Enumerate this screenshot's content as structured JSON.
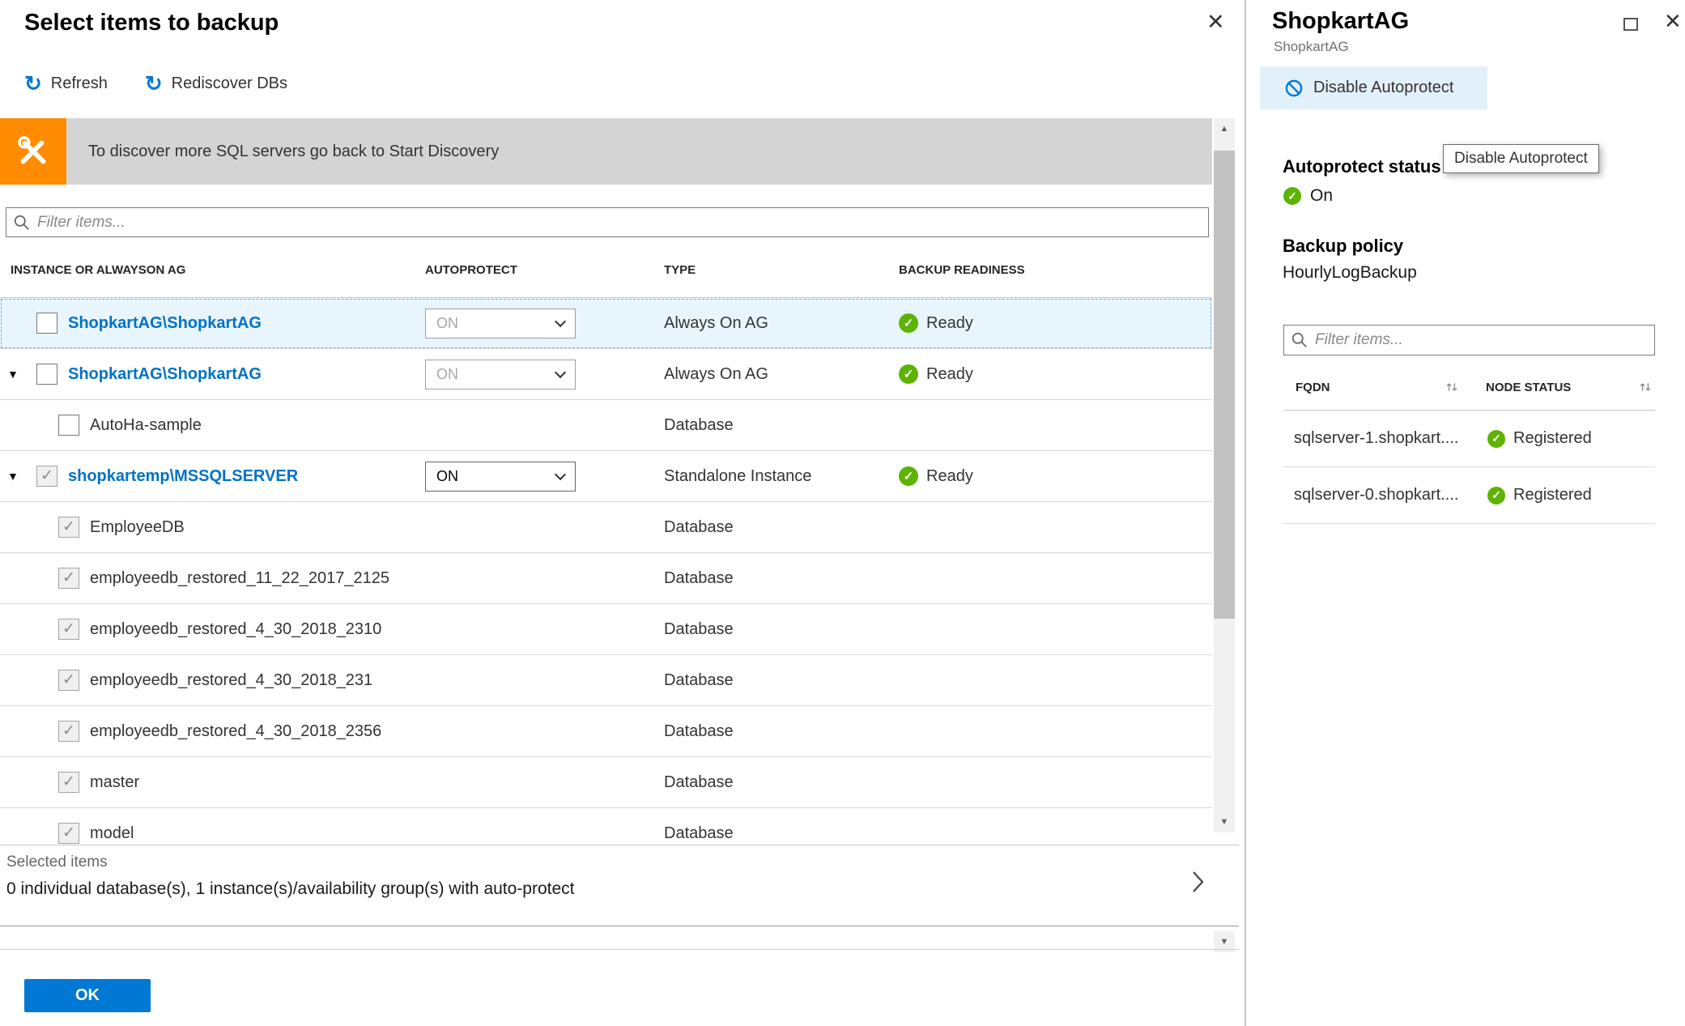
{
  "icons": {
    "close": "✕",
    "refresh": "↻",
    "caret_down": "▼",
    "check": "✓",
    "scroll_up": "▲",
    "scroll_down": "▼"
  },
  "colors": {
    "accent_blue": "#0078d4",
    "link_blue": "#0072c6",
    "status_green": "#5db300",
    "banner_gray": "#d4d4d4",
    "banner_icon_orange": "#ff8c00",
    "selected_row_blue": "#e8f5fd",
    "toolbar_highlight_blue": "#e2f0fa"
  },
  "left_blade": {
    "title": "Select items to backup",
    "toolbar": {
      "refresh_label": "Refresh",
      "rediscover_label": "Rediscover DBs"
    },
    "banner_text": "To discover more SQL servers go back to Start Discovery",
    "filter_placeholder": "Filter items...",
    "table": {
      "headers": {
        "instance": "INSTANCE OR ALWAYSON AG",
        "autoprotect": "AUTOPROTECT",
        "type": "TYPE",
        "readiness": "BACKUP READINESS"
      },
      "rows": [
        {
          "name": "ShopkartAG\\ShopkartAG",
          "link": true,
          "caret": false,
          "indent": false,
          "checked": false,
          "autoprotect": "ON",
          "autoprotect_enabled": false,
          "type": "Always On AG",
          "readiness": "Ready",
          "selected": true
        },
        {
          "name": "ShopkartAG\\ShopkartAG",
          "link": true,
          "caret": true,
          "indent": false,
          "checked": false,
          "autoprotect": "ON",
          "autoprotect_enabled": false,
          "type": "Always On AG",
          "readiness": "Ready",
          "selected": false
        },
        {
          "name": "AutoHa-sample",
          "link": false,
          "caret": false,
          "indent": true,
          "checked": false,
          "autoprotect": null,
          "autoprotect_enabled": false,
          "type": "Database",
          "readiness": null,
          "selected": false
        },
        {
          "name": "shopkartemp\\MSSQLSERVER",
          "link": true,
          "caret": true,
          "indent": false,
          "checked": true,
          "autoprotect": "ON",
          "autoprotect_enabled": true,
          "type": "Standalone Instance",
          "readiness": "Ready",
          "selected": false
        },
        {
          "name": "EmployeeDB",
          "link": false,
          "caret": false,
          "indent": true,
          "checked": true,
          "autoprotect": null,
          "autoprotect_enabled": false,
          "type": "Database",
          "readiness": null,
          "selected": false
        },
        {
          "name": "employeedb_restored_11_22_2017_2125",
          "link": false,
          "caret": false,
          "indent": true,
          "checked": true,
          "autoprotect": null,
          "autoprotect_enabled": false,
          "type": "Database",
          "readiness": null,
          "selected": false
        },
        {
          "name": "employeedb_restored_4_30_2018_2310",
          "link": false,
          "caret": false,
          "indent": true,
          "checked": true,
          "autoprotect": null,
          "autoprotect_enabled": false,
          "type": "Database",
          "readiness": null,
          "selected": false
        },
        {
          "name": "employeedb_restored_4_30_2018_231",
          "link": false,
          "caret": false,
          "indent": true,
          "checked": true,
          "autoprotect": null,
          "autoprotect_enabled": false,
          "type": "Database",
          "readiness": null,
          "selected": false
        },
        {
          "name": "employeedb_restored_4_30_2018_2356",
          "link": false,
          "caret": false,
          "indent": true,
          "checked": true,
          "autoprotect": null,
          "autoprotect_enabled": false,
          "type": "Database",
          "readiness": null,
          "selected": false
        },
        {
          "name": "master",
          "link": false,
          "caret": false,
          "indent": true,
          "checked": true,
          "autoprotect": null,
          "autoprotect_enabled": false,
          "type": "Database",
          "readiness": null,
          "selected": false
        },
        {
          "name": "model",
          "link": false,
          "caret": false,
          "indent": true,
          "checked": true,
          "autoprotect": null,
          "autoprotect_enabled": false,
          "type": "Database",
          "readiness": null,
          "selected": false
        }
      ]
    },
    "footer": {
      "label": "Selected items",
      "value": "0 individual database(s), 1 instance(s)/availability group(s) with auto-protect"
    },
    "ok_label": "OK"
  },
  "right_blade": {
    "title": "ShopkartAG",
    "subtitle": "ShopkartAG",
    "toolbar": {
      "disable_autoprotect_label": "Disable Autoprotect"
    },
    "tooltip_text": "Disable Autoprotect",
    "autoprotect": {
      "label": "Autoprotect status",
      "value": "On"
    },
    "backup_policy": {
      "label": "Backup policy",
      "value": "HourlyLogBackup"
    },
    "filter_placeholder": "Filter items...",
    "table": {
      "headers": {
        "fqdn": "FQDN",
        "node_status": "NODE STATUS"
      },
      "rows": [
        {
          "fqdn": "sqlserver-1.shopkart....",
          "status": "Registered"
        },
        {
          "fqdn": "sqlserver-0.shopkart....",
          "status": "Registered"
        }
      ]
    }
  }
}
